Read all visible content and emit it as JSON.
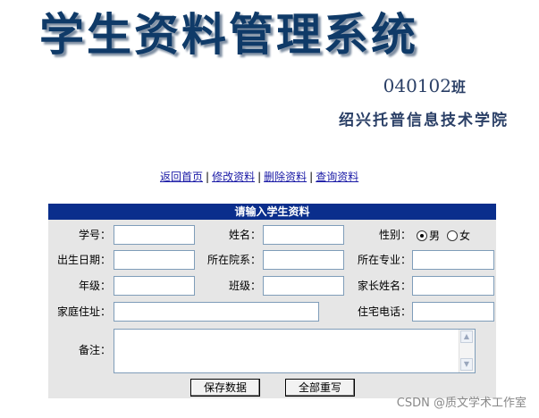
{
  "header": {
    "title": "学生资料管理系统",
    "class_name": "040102",
    "class_suffix": "班",
    "school": "绍兴托普信息技术学院"
  },
  "nav": {
    "home": "返回首页",
    "edit": "修改资料",
    "delete": "删除资料",
    "query": "查询资料",
    "separator": "|"
  },
  "form": {
    "heading": "请输入学生资料",
    "labels": {
      "student_id": "学号：",
      "name": "姓名：",
      "gender": "性别：",
      "birth_date": "出生日期：",
      "department": "所在院系：",
      "major": "所在专业：",
      "grade": "年级：",
      "class": "班级：",
      "parent_name": "家长姓名：",
      "address": "家庭住址：",
      "home_phone": "住宅电话：",
      "remarks": "备注："
    },
    "values": {
      "student_id": "",
      "name": "",
      "birth_date": "",
      "department": "",
      "major": "",
      "grade": "",
      "class": "",
      "parent_name": "",
      "address": "",
      "home_phone": "",
      "remarks": ""
    },
    "gender_options": [
      "男",
      "女"
    ],
    "gender_selected": "男",
    "buttons": {
      "save": "保存数据",
      "reset": "全部重写"
    }
  },
  "watermark": "CSDN @质文学术工作室",
  "colors": {
    "title": "#0f3a68",
    "header_bar": "#0a2e8c",
    "panel": "#e6e6e6",
    "link": "#1a1aa6"
  }
}
